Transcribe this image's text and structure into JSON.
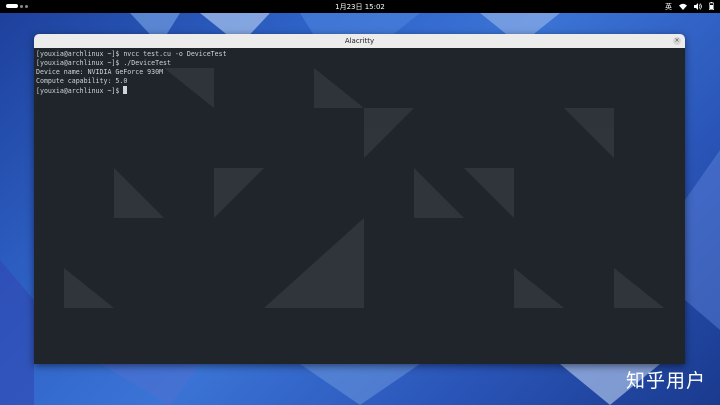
{
  "topbar": {
    "clock": "1月23日 15:02",
    "input_method": "英",
    "wifi_icon": "wifi-icon",
    "volume_icon": "volume-icon",
    "battery_icon": "battery-icon"
  },
  "window": {
    "title": "Alacritty",
    "close": "×"
  },
  "terminal": {
    "lines": [
      "[youxia@archlinux ~]$ nvcc test.cu -o DeviceTest",
      "[youxia@archlinux ~]$ ./DeviceTest",
      "Device name: NVIDIA GeForce 930M",
      "Compute capability: 5.0"
    ],
    "prompt": "[youxia@archlinux ~]$ "
  },
  "watermark": "知乎用户"
}
